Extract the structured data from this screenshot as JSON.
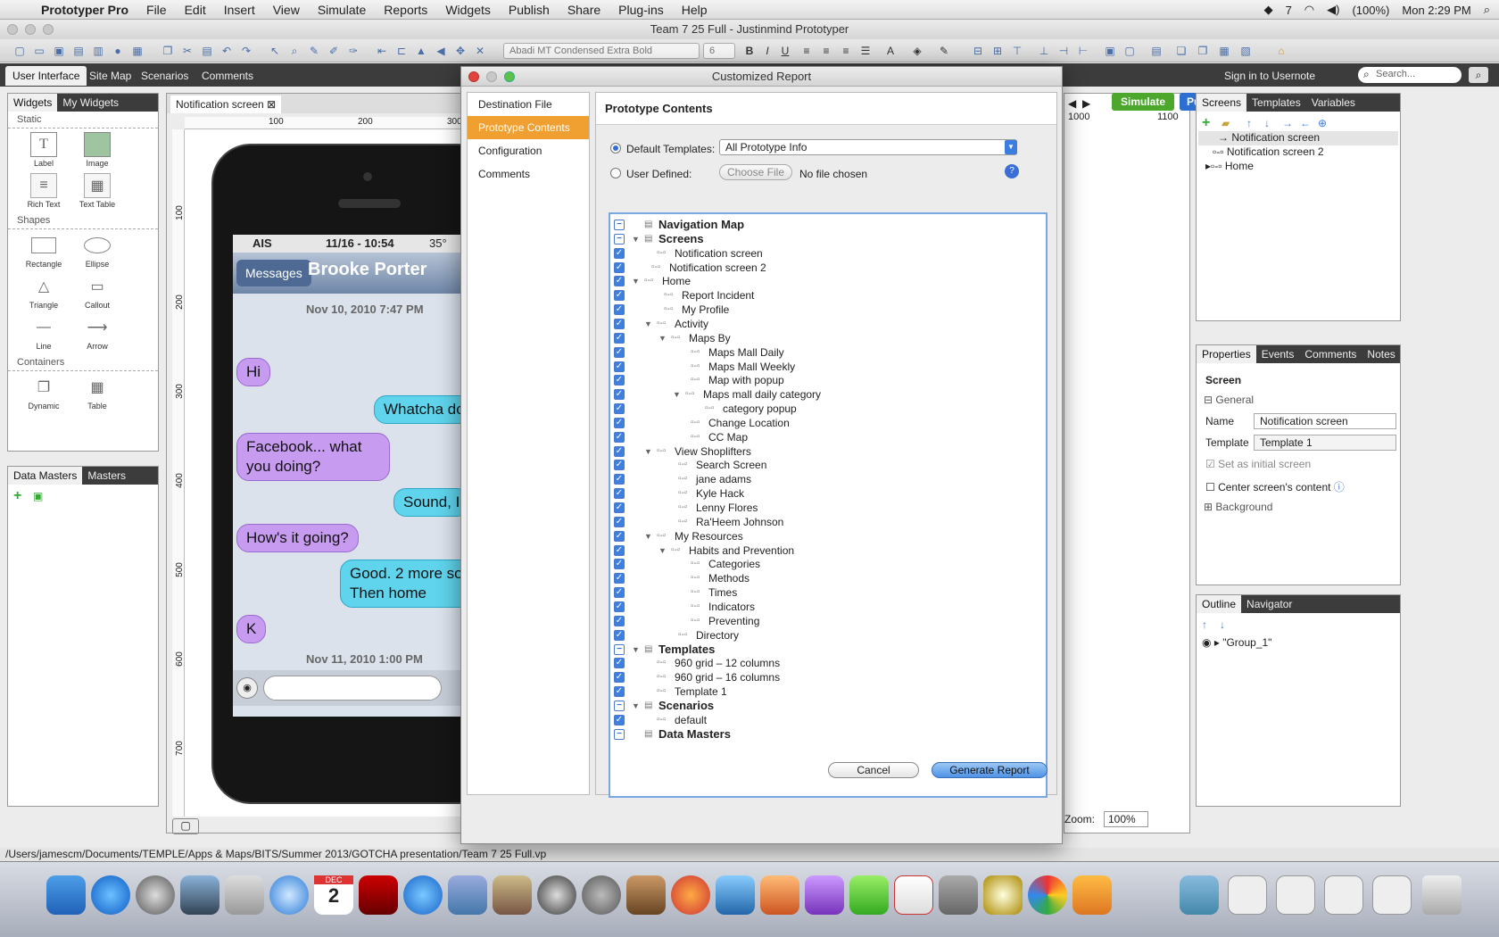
{
  "menubar": {
    "app_name": "Prototyper Pro",
    "items": [
      "File",
      "Edit",
      "Insert",
      "View",
      "Simulate",
      "Reports",
      "Widgets",
      "Publish",
      "Share",
      "Plug-ins",
      "Help"
    ],
    "status": {
      "battery": "(100%)",
      "clock": "Mon 2:29 PM",
      "badge": "7"
    }
  },
  "window": {
    "title": "Team 7 25 Full - Justinmind Prototyper"
  },
  "toolbar": {
    "font": "Abadi MT Condensed Extra Bold",
    "font_size": "6"
  },
  "top_tabs": [
    "User Interface",
    "Site Map",
    "Scenarios",
    "Comments"
  ],
  "top_right": {
    "signin": "Sign in to Usernote",
    "search_placeholder": "Search..."
  },
  "left_panel": {
    "tabs": [
      "Widgets",
      "My Widgets"
    ],
    "sections": {
      "static": "Static",
      "shapes": "Shapes",
      "containers": "Containers"
    },
    "static_items": [
      "Label",
      "Image",
      "Rich Text",
      "Text Table"
    ],
    "shape_items": [
      "Rectangle",
      "Ellipse",
      "Triangle",
      "Callout",
      "Line",
      "Arrow"
    ],
    "container_items": [
      "Dynamic",
      "Table"
    ],
    "bottom_tabs": [
      "Data Masters",
      "Masters"
    ]
  },
  "canvas": {
    "tab": "Notification screen",
    "ruler_x": [
      "100",
      "200",
      "300"
    ],
    "ruler_y": [
      "100",
      "200",
      "300",
      "400",
      "500",
      "600",
      "700"
    ],
    "phone": {
      "carrier": "AIS",
      "time": "11/16 - 10:54",
      "temp": "35°",
      "back": "Messages",
      "contact": "Brooke Porter",
      "date1": "Nov 10, 2010 7:47 PM",
      "date2": "Nov 11, 2010 1:00 PM",
      "messages": [
        "Hi",
        "Whatcha do",
        "Facebook... what you doing?",
        "Sound, I",
        "How's it going?",
        "Good. 2 more sor Then home",
        "K"
      ]
    }
  },
  "dialog": {
    "title": "Customized Report",
    "nav": [
      "Destination File",
      "Prototype Contents",
      "Configuration",
      "Comments"
    ],
    "header": "Prototype Contents",
    "default_templates_label": "Default Templates:",
    "default_templates_value": "All Prototype Info",
    "user_defined_label": "User Defined:",
    "choose_file": "Choose File",
    "no_file": "No file chosen",
    "tree": [
      {
        "label": "Navigation Map",
        "bold": true
      },
      {
        "label": "Screens",
        "bold": true
      },
      {
        "label": "Notification screen"
      },
      {
        "label": "Notification screen 2"
      },
      {
        "label": "Home"
      },
      {
        "label": "Report Incident"
      },
      {
        "label": "My Profile"
      },
      {
        "label": "Activity"
      },
      {
        "label": "Maps By"
      },
      {
        "label": "Maps Mall Daily"
      },
      {
        "label": "Maps Mall Weekly"
      },
      {
        "label": "Map with popup"
      },
      {
        "label": "Maps mall daily category"
      },
      {
        "label": "category popup"
      },
      {
        "label": "Change Location"
      },
      {
        "label": "CC Map"
      },
      {
        "label": "View Shoplifters"
      },
      {
        "label": "Search Screen"
      },
      {
        "label": "jane adams"
      },
      {
        "label": "Kyle Hack"
      },
      {
        "label": "Lenny Flores"
      },
      {
        "label": "Ra'Heem Johnson"
      },
      {
        "label": "My Resources"
      },
      {
        "label": "Habits and Prevention"
      },
      {
        "label": "Categories"
      },
      {
        "label": "Methods"
      },
      {
        "label": "Times"
      },
      {
        "label": "Indicators"
      },
      {
        "label": "Preventing"
      },
      {
        "label": "Directory"
      },
      {
        "label": "Templates",
        "bold": true
      },
      {
        "label": "960 grid – 12 columns"
      },
      {
        "label": "960 grid – 16 columns"
      },
      {
        "label": "Template 1"
      },
      {
        "label": "Scenarios",
        "bold": true
      },
      {
        "label": "default"
      },
      {
        "label": "Data Masters",
        "bold": true
      }
    ],
    "cancel": "Cancel",
    "generate": "Generate Report"
  },
  "canvas_right": {
    "simulate": "Simulate",
    "publish": "Publish Online",
    "ruler": [
      "1000",
      "1100"
    ],
    "zoom_label": "Zoom:",
    "zoom_value": "100%"
  },
  "right_panel": {
    "tabs": [
      "Screens",
      "Templates",
      "Variables"
    ],
    "screens": [
      "Notification screen",
      "Notification screen 2",
      "Home"
    ],
    "prop_tabs": [
      "Properties",
      "Events",
      "Comments",
      "Notes"
    ],
    "prop_title": "Screen",
    "general": "General",
    "name_label": "Name",
    "name_value": "Notification screen",
    "template_label": "Template",
    "template_value": "Template 1",
    "initial": "Set as initial screen",
    "center": "Center screen's content",
    "background": "Background",
    "outline_tabs": [
      "Outline",
      "Navigator"
    ],
    "outline_item": "\"Group_1\""
  },
  "statusbar": {
    "path": "/Users/jamescm/Documents/TEMPLE/Apps & Maps/BITS/Summer 2013/GOTCHA presentation/Team 7 25 Full.vp"
  },
  "dock": {
    "calendar_day": "2",
    "calendar_month": "DEC"
  }
}
